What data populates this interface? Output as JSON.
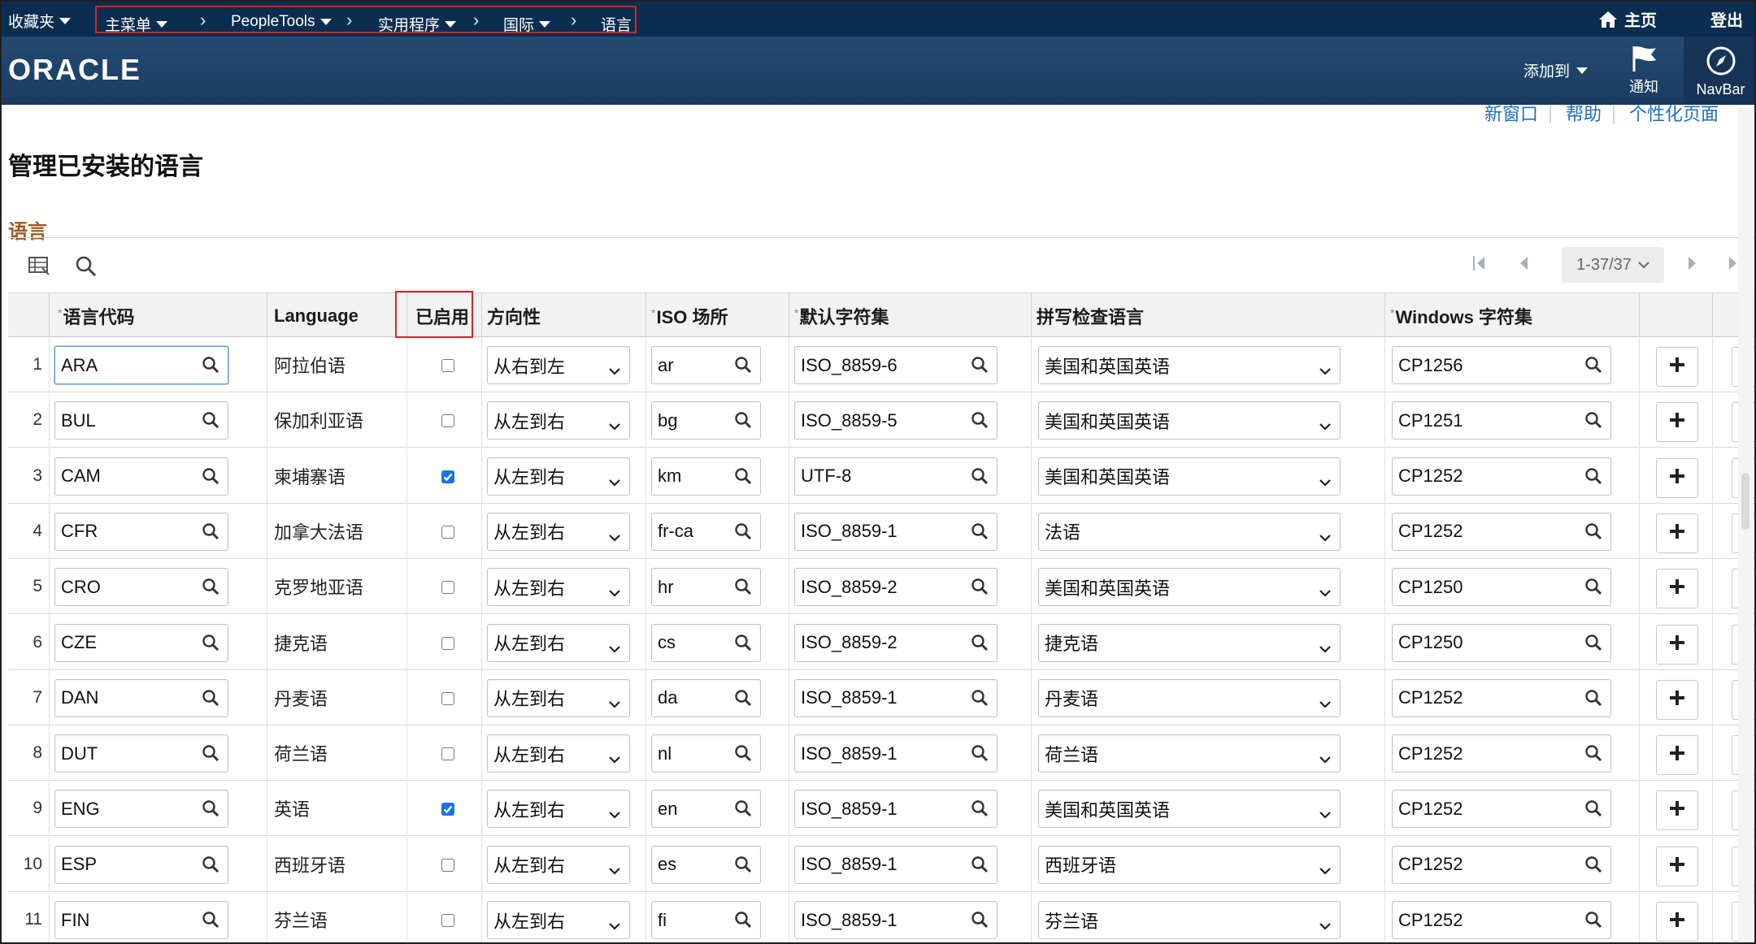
{
  "topbar": {
    "favorites": "收藏夹",
    "breadcrumbs": [
      {
        "label": "主菜单",
        "dropdown": true
      },
      {
        "label": "PeopleTools",
        "dropdown": true
      },
      {
        "label": "实用程序",
        "dropdown": true
      },
      {
        "label": "国际",
        "dropdown": true
      },
      {
        "label": "语言",
        "dropdown": false
      }
    ],
    "home": "主页",
    "logout": "登出"
  },
  "header": {
    "logo": "ORACLE",
    "add_to": "添加到",
    "notify": "通知",
    "navbar": "NavBar"
  },
  "page_links": [
    "新窗口",
    "帮助",
    "个性化页面"
  ],
  "page_title": "管理已安装的语言",
  "section_title": "语言",
  "pager": {
    "range": "1-37/37"
  },
  "columns": {
    "lang_code": "语言代码",
    "language": "Language",
    "enabled": "已启用",
    "direction": "方向性",
    "iso_locale": "ISO 场所",
    "default_charset": "默认字符集",
    "spell_check": "拼写检查语言",
    "windows_charset": "Windows 字符集"
  },
  "rows": [
    {
      "num": "1",
      "code": "ARA",
      "language": "阿拉伯语",
      "enabled": false,
      "direction": "从右到左",
      "iso": "ar",
      "charset": "ISO_8859-6",
      "spell": "美国和英国英语",
      "win": "CP1256"
    },
    {
      "num": "2",
      "code": "BUL",
      "language": "保加利亚语",
      "enabled": false,
      "direction": "从左到右",
      "iso": "bg",
      "charset": "ISO_8859-5",
      "spell": "美国和英国英语",
      "win": "CP1251"
    },
    {
      "num": "3",
      "code": "CAM",
      "language": "柬埔寨语",
      "enabled": true,
      "direction": "从左到右",
      "iso": "km",
      "charset": "UTF-8",
      "spell": "美国和英国英语",
      "win": "CP1252"
    },
    {
      "num": "4",
      "code": "CFR",
      "language": "加拿大法语",
      "enabled": false,
      "direction": "从左到右",
      "iso": "fr-ca",
      "charset": "ISO_8859-1",
      "spell": "法语",
      "win": "CP1252"
    },
    {
      "num": "5",
      "code": "CRO",
      "language": "克罗地亚语",
      "enabled": false,
      "direction": "从左到右",
      "iso": "hr",
      "charset": "ISO_8859-2",
      "spell": "美国和英国英语",
      "win": "CP1250"
    },
    {
      "num": "6",
      "code": "CZE",
      "language": "捷克语",
      "enabled": false,
      "direction": "从左到右",
      "iso": "cs",
      "charset": "ISO_8859-2",
      "spell": "捷克语",
      "win": "CP1250"
    },
    {
      "num": "7",
      "code": "DAN",
      "language": "丹麦语",
      "enabled": false,
      "direction": "从左到右",
      "iso": "da",
      "charset": "ISO_8859-1",
      "spell": "丹麦语",
      "win": "CP1252"
    },
    {
      "num": "8",
      "code": "DUT",
      "language": "荷兰语",
      "enabled": false,
      "direction": "从左到右",
      "iso": "nl",
      "charset": "ISO_8859-1",
      "spell": "荷兰语",
      "win": "CP1252"
    },
    {
      "num": "9",
      "code": "ENG",
      "language": "英语",
      "enabled": true,
      "direction": "从左到右",
      "iso": "en",
      "charset": "ISO_8859-1",
      "spell": "美国和英国英语",
      "win": "CP1252"
    },
    {
      "num": "10",
      "code": "ESP",
      "language": "西班牙语",
      "enabled": false,
      "direction": "从左到右",
      "iso": "es",
      "charset": "ISO_8859-1",
      "spell": "西班牙语",
      "win": "CP1252"
    },
    {
      "num": "11",
      "code": "FIN",
      "language": "芬兰语",
      "enabled": false,
      "direction": "从左到右",
      "iso": "fi",
      "charset": "ISO_8859-1",
      "spell": "芬兰语",
      "win": "CP1252"
    }
  ],
  "colors": {
    "topbar": "#0b2d4f",
    "header": "#1e4268",
    "link": "#1d6fb8",
    "section": "#a05a1e",
    "highlight": "#e02020",
    "checked": "#1a73e8"
  }
}
